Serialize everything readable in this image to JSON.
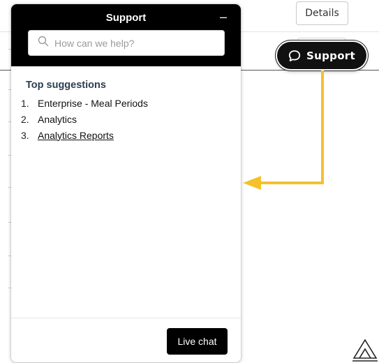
{
  "background": {
    "details_button_label": "Details",
    "support_pill_label": "Support",
    "support_pill_icon": "speech-bubble-icon"
  },
  "widget": {
    "title": "Support",
    "minimize_glyph": "–",
    "search": {
      "placeholder": "How can we help?",
      "value": "",
      "icon": "search-icon"
    },
    "suggestions": {
      "heading": "Top suggestions",
      "items": [
        {
          "number": "1.",
          "label": "Enterprise - Meal Periods",
          "underlined": false
        },
        {
          "number": "2.",
          "label": "Analytics",
          "underlined": false
        },
        {
          "number": "3.",
          "label": "Analytics Reports",
          "underlined": true
        }
      ]
    },
    "live_chat_label": "Live chat"
  },
  "colors": {
    "header_bg": "#000000",
    "arrow_annotation": "#f5c12b",
    "pill_bg": "#111111"
  }
}
